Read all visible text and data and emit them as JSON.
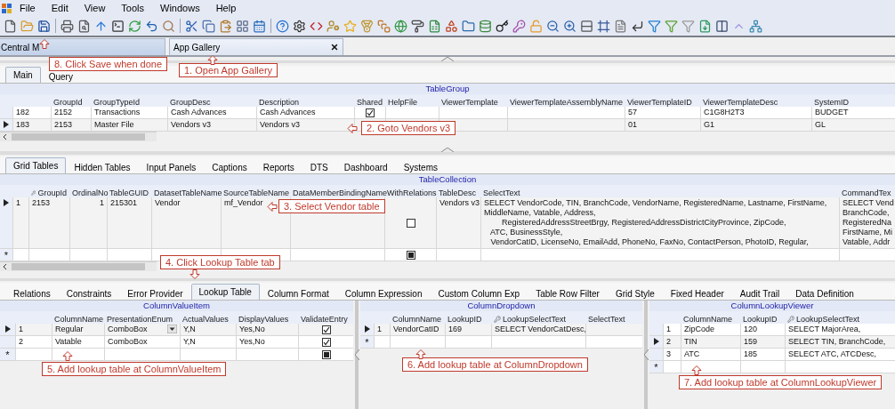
{
  "menu": [
    "File",
    "Edit",
    "View",
    "Tools",
    "Windows",
    "Help"
  ],
  "doc_tabs": [
    {
      "label": "Central M",
      "selected": false
    },
    {
      "label": "App Gallery",
      "selected": true
    }
  ],
  "main_tabs": [
    {
      "label": "Main",
      "selected": true
    },
    {
      "label": "Query",
      "selected": false
    }
  ],
  "table_group": {
    "title": "TableGroup",
    "columns": [
      {
        "kind": "index"
      },
      {
        "label": "GroupId",
        "kind": "text"
      },
      {
        "label": "GroupTypeId",
        "kind": "text"
      },
      {
        "label": "GroupDesc",
        "kind": "text"
      },
      {
        "label": "Description",
        "kind": "text"
      },
      {
        "label": "Shared",
        "kind": "check"
      },
      {
        "label": "HelpFile",
        "kind": "text"
      },
      {
        "label": "ViewerTemplate",
        "kind": "text"
      },
      {
        "label": "ViewerTemplateAssemblyName",
        "kind": "text"
      },
      {
        "label": "ViewerTemplateID",
        "kind": "text"
      },
      {
        "label": "ViewerTemplateDesc",
        "kind": "text"
      },
      {
        "label": "SystemID",
        "kind": "text"
      }
    ],
    "rows": [
      {
        "kind": "data",
        "current": false,
        "cells": [
          "182",
          "2152",
          "Transactions",
          "Cash Advances",
          "Cash Advances",
          {
            "checked": true
          },
          null,
          null,
          null,
          "57",
          "C1G8H2T3",
          "BUDGET"
        ]
      },
      {
        "kind": "data",
        "current": true,
        "cells": [
          "183",
          "2153",
          "Master File",
          "Vendors v3",
          "Vendors v3",
          null,
          null,
          null,
          null,
          "01",
          "G1",
          "GL"
        ]
      }
    ]
  },
  "sub_tabs": [
    {
      "label": "Grid Tables",
      "selected": true
    },
    {
      "label": "Hidden Tables",
      "selected": false
    },
    {
      "label": "Input Panels",
      "selected": false
    },
    {
      "label": "Captions",
      "selected": false
    },
    {
      "label": "Reports",
      "selected": false
    },
    {
      "label": "DTS",
      "selected": false
    },
    {
      "label": "Dashboard",
      "selected": false
    },
    {
      "label": "Systems",
      "selected": false
    }
  ],
  "table_collection": {
    "title": "TableCollection",
    "columns": [
      {
        "kind": "index"
      },
      {
        "label": "GroupId",
        "kind": "key"
      },
      {
        "label": "OrdinalNo",
        "kind": "number"
      },
      {
        "label": "TableGUID",
        "kind": "text"
      },
      {
        "label": "DatasetTableName",
        "kind": "text"
      },
      {
        "label": "SourceTableName",
        "kind": "text"
      },
      {
        "label": "DataMemberBindingName",
        "kind": "text"
      },
      {
        "label": "WithRelations",
        "kind": "check"
      },
      {
        "label": "TableDesc",
        "kind": "text"
      },
      {
        "label": "SelectText",
        "kind": "text"
      },
      {
        "label": "CommandTex",
        "kind": "text"
      }
    ],
    "rows": [
      {
        "kind": "data",
        "current": true,
        "cells": [
          "1",
          "2153",
          "1",
          "215301",
          "Vendor",
          "mf_Vendor",
          null,
          {
            "checked": false
          },
          "Vendors v3",
          "SELECT VendorCode, TIN, BranchCode, VendorName, RegisteredName, Lastname, FirstName,\nMiddleName, Vatable, Address,\n        RegisteredAddressStreetBrgy, RegisteredAddressDistrictCityProvince, ZipCode,\n   ATC, BusinessStyle,\n   VendorCatID, LicenseNo, EmailAdd, PhoneNo, FaxNo, ContactPerson, PhotoID, Regular,",
          "SELECT Vend\nBranchCode,\nRegisteredNa\nFirstName, Mi\nVatable, Addr"
        ]
      },
      {
        "kind": "new",
        "current": false,
        "mark": "*"
      }
    ]
  },
  "detail_tabs": [
    {
      "label": "Relations",
      "selected": false
    },
    {
      "label": "Constraints",
      "selected": false
    },
    {
      "label": "Error Provider",
      "selected": false
    },
    {
      "label": "Lookup Table",
      "selected": true
    },
    {
      "label": "Column Format",
      "selected": false
    },
    {
      "label": "Column Expression",
      "selected": false
    },
    {
      "label": "Custom Column Exp",
      "selected": false
    },
    {
      "label": "Table Row Filter",
      "selected": false
    },
    {
      "label": "Grid Style",
      "selected": false
    },
    {
      "label": "Fixed Header",
      "selected": false
    },
    {
      "label": "Audit Trail",
      "selected": false
    },
    {
      "label": "Data Definition",
      "selected": false
    }
  ],
  "column_value_item": {
    "title": "ColumnValueItem",
    "columns": [
      {
        "kind": "index"
      },
      {
        "label": "ColumnName",
        "kind": "text"
      },
      {
        "label": "PresentationEnum",
        "kind": "combo"
      },
      {
        "label": "ActualValues",
        "kind": "text"
      },
      {
        "label": "DisplayValues",
        "kind": "text"
      },
      {
        "label": "ValidateEntry",
        "kind": "check"
      }
    ],
    "rows": [
      {
        "kind": "data",
        "current": true,
        "cells": [
          "1",
          "Regular",
          "ComboBox",
          "Y,N",
          "Yes,No",
          {
            "checked": true
          }
        ]
      },
      {
        "kind": "data",
        "current": false,
        "cells": [
          "2",
          "Vatable",
          "ComboBox",
          "Y,N",
          "Yes,No",
          {
            "checked": true
          }
        ]
      },
      {
        "kind": "new",
        "current": false,
        "mark": "*"
      }
    ]
  },
  "column_dropdown": {
    "title": "ColumnDropdown",
    "columns": [
      {
        "kind": "index"
      },
      {
        "label": "ColumnName",
        "kind": "text"
      },
      {
        "label": "LookupID",
        "kind": "text"
      },
      {
        "label": "LookupSelectText",
        "kind": "key"
      },
      {
        "label": "SelectText",
        "kind": "text"
      }
    ],
    "rows": [
      {
        "kind": "data",
        "current": true,
        "cells": [
          "1",
          "VendorCatID",
          "169",
          "SELECT VendorCatDesc,",
          null
        ]
      },
      {
        "kind": "new",
        "current": false,
        "mark": "*"
      }
    ]
  },
  "column_lookup_viewer": {
    "title": "ColumnLookupViewer",
    "columns": [
      {
        "kind": "index"
      },
      {
        "label": "ColumnName",
        "kind": "text"
      },
      {
        "label": "LookupID",
        "kind": "text"
      },
      {
        "label": "LookupSelectText",
        "kind": "key"
      }
    ],
    "rows": [
      {
        "kind": "data",
        "current": false,
        "cells": [
          "1",
          "ZipCode",
          "120",
          "SELECT MajorArea,"
        ]
      },
      {
        "kind": "data",
        "current": true,
        "cells": [
          "2",
          "TIN",
          "159",
          "SELECT TIN, BranchCode,"
        ]
      },
      {
        "kind": "data",
        "current": false,
        "cells": [
          "3",
          "ATC",
          "185",
          "SELECT ATC, ATCDesc,"
        ]
      },
      {
        "kind": "new",
        "current": false,
        "mark": "*"
      }
    ]
  },
  "annotations": [
    "8. Click Save when done",
    "1. Open App Gallery",
    "2. Goto Vendors v3",
    "3. Select Vendor table",
    "4. Click Lookup Table tab",
    "5. Add lookup table at ColumnValueItem",
    "6. Add lookup table at ColumnDropdown",
    "7. Add lookup table at ColumnLookupViewer"
  ]
}
